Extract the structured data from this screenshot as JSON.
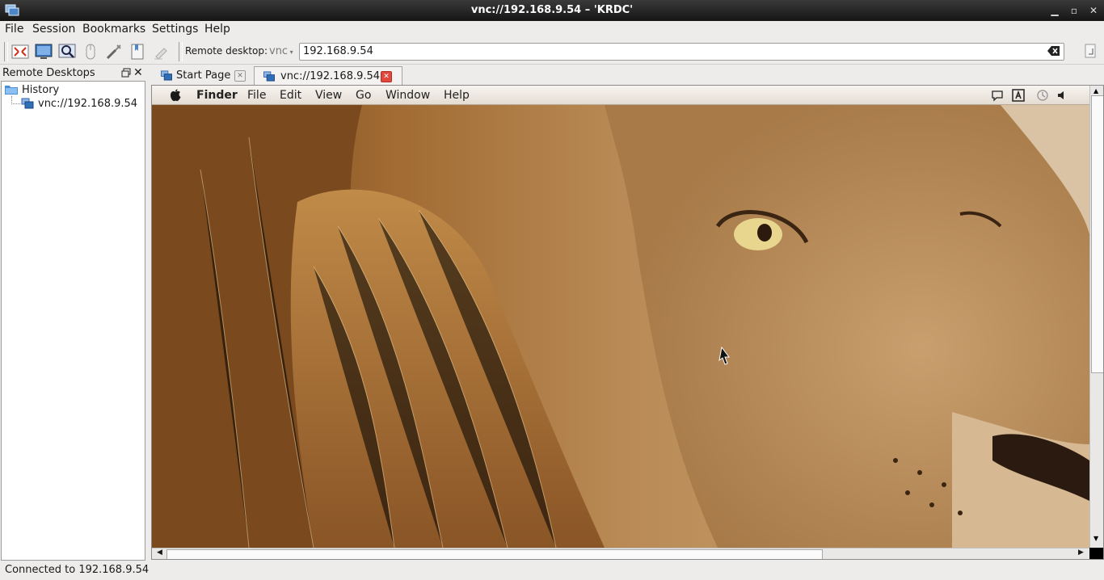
{
  "window": {
    "title": "vnc://192.168.9.54 – 'KRDC'"
  },
  "menubar": {
    "items": [
      "File",
      "Session",
      "Bookmarks",
      "Settings",
      "Help"
    ]
  },
  "toolbar": {
    "remote_label": "Remote desktop:",
    "protocol": "vnc",
    "address": "192.168.9.54",
    "buttons": [
      "fullscreen-icon",
      "switch-screen-icon",
      "scale-icon",
      "view-only-mouse-icon",
      "preferences-icon",
      "bookmark-icon",
      "clear-icon"
    ]
  },
  "sidebar": {
    "title": "Remote Desktops",
    "tree": {
      "group": "History",
      "items": [
        "vnc://192.168.9.54"
      ]
    }
  },
  "tabs": [
    {
      "label": "Start Page",
      "active": false
    },
    {
      "label": "vnc://192.168.9.54",
      "active": true
    }
  ],
  "remote": {
    "mac_menu": {
      "app": "Finder",
      "items": [
        "File",
        "Edit",
        "View",
        "Go",
        "Window",
        "Help"
      ]
    },
    "status_icons": [
      "chat-icon",
      "keyboard-layout-icon",
      "time-machine-icon",
      "volume-icon"
    ]
  },
  "statusbar": {
    "text": "Connected to 192.168.9.54"
  },
  "colors": {
    "titlebar": "#1e1e1e",
    "active_tab_close": "#e0483c",
    "mane": "#b07a3a"
  }
}
